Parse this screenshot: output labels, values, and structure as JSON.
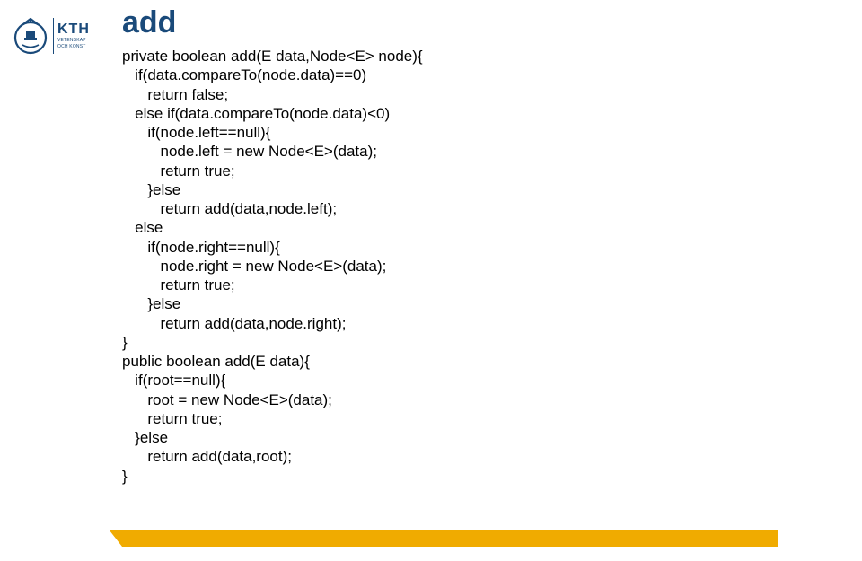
{
  "logo": {
    "main": "KTH",
    "sub1": "VETENSKAP",
    "sub2": "OCH KONST"
  },
  "title": "add",
  "code": {
    "l1": "private boolean add(E data,Node<E> node){",
    "l2": "   if(data.compareTo(node.data)==0)",
    "l3": "      return false;",
    "l4": "   else if(data.compareTo(node.data)<0)",
    "l5": "      if(node.left==null){",
    "l6": "         node.left = new Node<E>(data);",
    "l7": "         return true;",
    "l8": "      }else",
    "l9": "         return add(data,node.left);",
    "l10": "   else",
    "l11": "      if(node.right==null){",
    "l12": "         node.right = new Node<E>(data);",
    "l13": "         return true;",
    "l14": "      }else",
    "l15": "         return add(data,node.right);",
    "l16": "}",
    "l17": "public boolean add(E data){",
    "l18": "   if(root==null){",
    "l19": "      root = new Node<E>(data);",
    "l20": "      return true;",
    "l21": "   }else",
    "l22": "      return add(data,root);",
    "l23": "}"
  }
}
